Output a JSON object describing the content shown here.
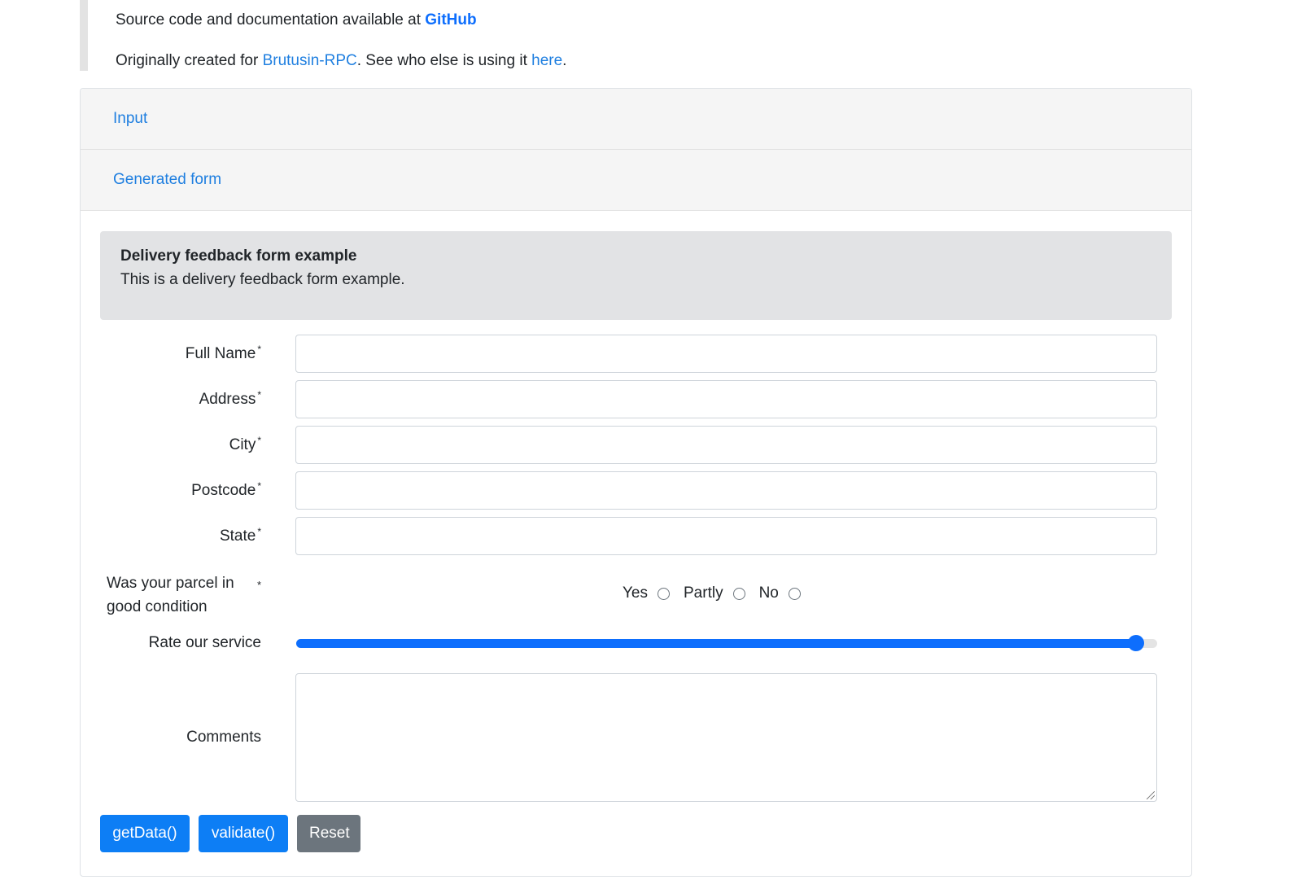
{
  "intro": {
    "line1_text": "Source code and documentation available at ",
    "line1_link": "GitHub",
    "line2_prefix": "Originally created for ",
    "line2_link1": "Brutusin-RPC",
    "line2_middle": ". See who else is using it ",
    "line2_link2": "here",
    "line2_suffix": "."
  },
  "accordion": {
    "input_label": "Input",
    "generated_label": "Generated form"
  },
  "form": {
    "title": "Delivery feedback form example",
    "description": "This is a delivery feedback form example.",
    "required_marker": "*",
    "fields": [
      {
        "label": "Full Name",
        "value": ""
      },
      {
        "label": "Address",
        "value": ""
      },
      {
        "label": "City",
        "value": ""
      },
      {
        "label": "Postcode",
        "value": ""
      },
      {
        "label": "State",
        "value": ""
      }
    ],
    "condition": {
      "label": "Was your parcel in good condition",
      "options": [
        "Yes",
        "Partly",
        "No"
      ]
    },
    "rating": {
      "label": "Rate our service",
      "value_fraction": 0.975
    },
    "comments": {
      "label": "Comments",
      "value": ""
    }
  },
  "buttons": {
    "get_data": "getData()",
    "validate": "validate()",
    "reset": "Reset"
  },
  "colors": {
    "link": "#1f7fe0",
    "primary": "#0d7ef5",
    "secondary": "#6c757d",
    "well": "#e2e3e5"
  }
}
